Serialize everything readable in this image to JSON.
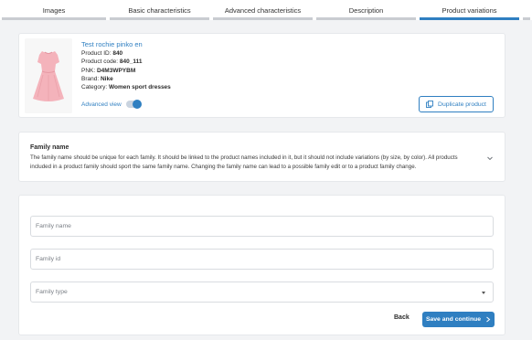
{
  "tabs": [
    {
      "label": "Images"
    },
    {
      "label": "Basic characteristics"
    },
    {
      "label": "Advanced characteristics"
    },
    {
      "label": "Description"
    },
    {
      "label": "Product variations"
    }
  ],
  "product": {
    "title": "Test rochie pinko en",
    "id_label": "Product ID:",
    "id_value": "840",
    "code_label": "Product code:",
    "code_value": "840_111",
    "pnk_label": "PNK:",
    "pnk_value": "D4M3WPYBM",
    "brand_label": "Brand:",
    "brand_value": "Nike",
    "category_label": "Category:",
    "category_value": "Women sport dresses",
    "advanced_view_label": "Advanced view",
    "advanced_view_on": true,
    "duplicate_label": "Duplicate product"
  },
  "family_info": {
    "title": "Family name",
    "text": "The family name should be unique for each family. It should be linked to the product names included in it, but it should not include variations (by size, by color). All products included in a product family should sport the same family name. Changing the family name can lead to a possible family edit or to a product family change."
  },
  "form": {
    "family_name_placeholder": "Family name",
    "family_id_placeholder": "Family id",
    "family_type_placeholder": "Family type",
    "back_label": "Back",
    "save_label": "Save and continue"
  },
  "colors": {
    "accent": "#2f7fc1",
    "tab_inactive": "#c9ccd1"
  }
}
